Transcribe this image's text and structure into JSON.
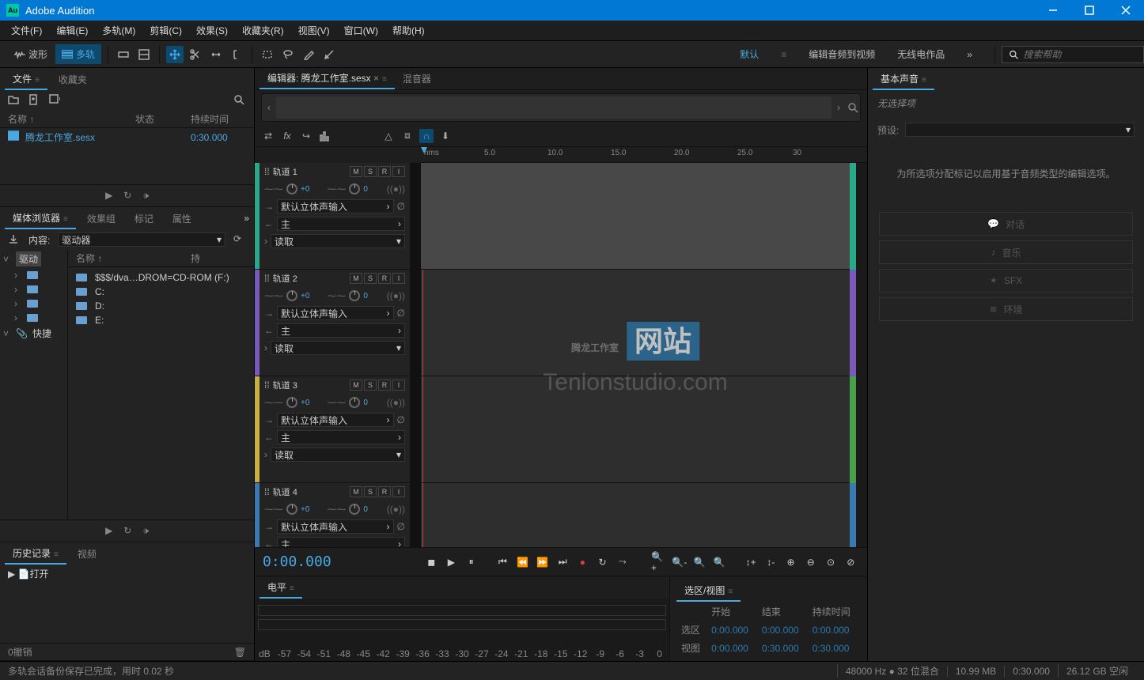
{
  "app": {
    "title": "Adobe Audition"
  },
  "menu": [
    "文件(F)",
    "编辑(E)",
    "多轨(M)",
    "剪辑(C)",
    "效果(S)",
    "收藏夹(R)",
    "视图(V)",
    "窗口(W)",
    "帮助(H)"
  ],
  "modes": {
    "waveform": "波形",
    "multitrack": "多轨"
  },
  "workspaces": {
    "default": "默认",
    "editAV": "编辑音频到视频",
    "radio": "无线电作品"
  },
  "search": {
    "placeholder": "搜索帮助"
  },
  "filesPanel": {
    "tabs": {
      "files": "文件",
      "favorites": "收藏夹"
    },
    "cols": {
      "name": "名称 ↑",
      "status": "状态",
      "duration": "持续时间"
    },
    "items": [
      {
        "name": "腾龙工作室.sesx",
        "duration": "0:30.000"
      }
    ]
  },
  "mediaBrowser": {
    "tabs": {
      "media": "媒体浏览器",
      "fxgroup": "效果组",
      "markers": "标记",
      "props": "属性"
    },
    "contentLabel": "内容:",
    "driver": "驱动器",
    "cols": {
      "name": "名称 ↑",
      "duration": "持"
    },
    "rootLabel": "驱动",
    "items": [
      "$$$/dva…DROM=CD-ROM (F:)",
      "C:",
      "D:",
      "E:"
    ],
    "quick": "快捷"
  },
  "history": {
    "tab": "历史记录",
    "video": "视频",
    "open": "打开",
    "undo": "0撤销"
  },
  "editor": {
    "tab": "编辑器: 腾龙工作室.sesx",
    "mixer": "混音器",
    "rulerUnit": "hms",
    "rulerTicks": [
      "5.0",
      "10.0",
      "15.0",
      "20.0",
      "25.0",
      "30"
    ],
    "tracks": [
      {
        "name": "轨道 1",
        "color": "#2aa88a",
        "input": "默认立体声输入",
        "output": "主",
        "mode": "读取",
        "vol": "+0",
        "pan": "0"
      },
      {
        "name": "轨道 2",
        "color": "#7a5ab8",
        "input": "默认立体声输入",
        "output": "主",
        "mode": "读取",
        "vol": "+0",
        "pan": "0"
      },
      {
        "name": "轨道 3",
        "color": "#c8b040",
        "input": "默认立体声输入",
        "output": "主",
        "mode": "读取",
        "vol": "+0",
        "pan": "0"
      },
      {
        "name": "轨道 4",
        "color": "#3a7ab0",
        "input": "默认立体声输入",
        "output": "主",
        "mode": "",
        "vol": "+0",
        "pan": "0"
      }
    ],
    "rightColors": [
      "#2aa88a",
      "#7a5ab8",
      "#7a5ab8",
      "#48a048",
      "#3a7ab0"
    ]
  },
  "transport": {
    "time": "0:00.000"
  },
  "levels": {
    "label": "电平",
    "db": [
      "dB",
      "-57",
      "-54",
      "-51",
      "-48",
      "-45",
      "-42",
      "-39",
      "-36",
      "-33",
      "-30",
      "-27",
      "-24",
      "-21",
      "-18",
      "-15",
      "-12",
      "-9",
      "-6",
      "-3",
      "0"
    ]
  },
  "essential": {
    "title": "基本声音",
    "noselect": "无选择项",
    "preset": "预设:",
    "hint": "为所选项分配标记以启用基于音频类型的编辑选项。",
    "buttons": {
      "dialog": "对话",
      "music": "音乐",
      "sfx": "SFX",
      "ambience": "环境"
    }
  },
  "selView": {
    "title": "选区/视图",
    "cols": {
      "start": "开始",
      "end": "结束",
      "dur": "持续时间"
    },
    "rows": {
      "sel": {
        "label": "选区",
        "start": "0:00.000",
        "end": "0:00.000",
        "dur": "0:00.000"
      },
      "view": {
        "label": "视图",
        "start": "0:00.000",
        "end": "0:30.000",
        "dur": "0:30.000"
      }
    }
  },
  "status": {
    "msg": "多轨会话备份保存已完成，用时 0.02 秒",
    "sr": "48000 Hz",
    "bits": "32 位混合",
    "mem": "10.99 MB",
    "dur": "0:30.000",
    "disk": "26.12 GB 空闲"
  },
  "watermark": {
    "cn": "腾龙工作室",
    "badge": "网站",
    "en": "Tenlonstudio.com"
  }
}
